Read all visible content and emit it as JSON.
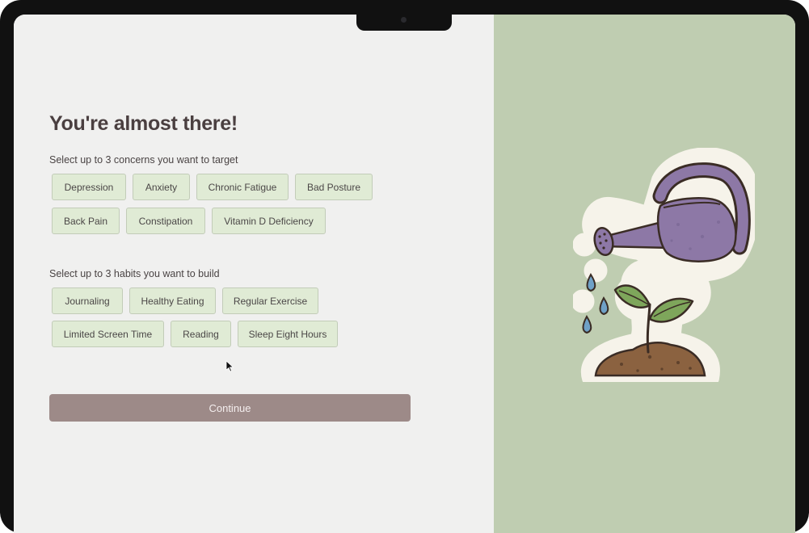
{
  "onboarding": {
    "title": "You're almost there!",
    "concerns_label": "Select up to 3 concerns you want to target",
    "concerns": [
      "Depression",
      "Anxiety",
      "Chronic Fatigue",
      "Bad Posture",
      "Back Pain",
      "Constipation",
      "Vitamin D Deficiency"
    ],
    "habits_label": "Select up to 3 habits you want to build",
    "habits": [
      "Journaling",
      "Healthy Eating",
      "Regular Exercise",
      "Limited Screen Time",
      "Reading",
      "Sleep Eight Hours"
    ],
    "continue_label": "Continue"
  },
  "illustration": {
    "icon": "watering-can-seedling-illustration"
  },
  "colors": {
    "chip_bg": "#e0ebd5",
    "chip_border": "#c2ccb8",
    "button_bg": "#9d8a88",
    "right_panel_bg": "#bfcdb1",
    "left_panel_bg": "#f0f0ef",
    "title": "#4a3f40"
  }
}
